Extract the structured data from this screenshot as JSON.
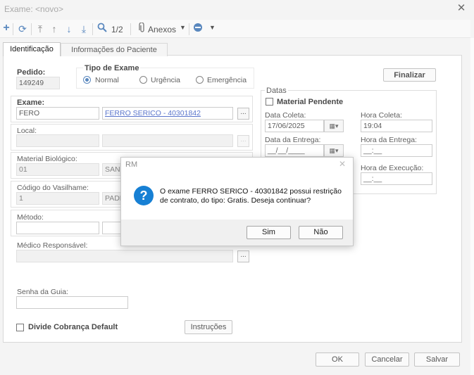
{
  "window": {
    "title": "Exame: <novo>"
  },
  "toolbar": {
    "page_indicator": "1/2",
    "attachments_label": "Anexos"
  },
  "tabs": [
    {
      "label": "Identificação"
    },
    {
      "label": "Informações do Paciente"
    }
  ],
  "form": {
    "pedido_label": "Pedido:",
    "pedido_value": "149249",
    "tipo_exame_label": "Tipo de Exame",
    "tipo_options": [
      "Normal",
      "Urgência",
      "Emergência"
    ],
    "exame_label": "Exame:",
    "exame_code": "FERO",
    "exame_desc": "FERRO SERICO - 40301842",
    "local_label": "Local:",
    "material_label": "Material Biológico:",
    "material_code": "01",
    "material_desc": "SANG",
    "vasilhame_label": "Código do Vasilhame:",
    "vasilhame_code": "1",
    "vasilhame_desc": "PADR",
    "metodo_label": "Método:",
    "medico_label": "Médico Responsável:",
    "senha_label": "Senha da Guia:",
    "divide_label": "Divide Cobrança Default",
    "instrucoes_btn": "Instruções",
    "finalizar_btn": "Finalizar",
    "dots": "..."
  },
  "datas": {
    "title": "Datas",
    "material_pendente": "Material Pendente",
    "data_coleta_label": "Data Coleta:",
    "data_coleta_value": "17/06/2025",
    "hora_coleta_label": "Hora Coleta:",
    "hora_coleta_value": "19:04",
    "data_entrega_label": "Data da Entrega:",
    "data_entrega_value": "__/__/____",
    "hora_entrega_label": "Hora da Entrega:",
    "hora_entrega_value": "__:__",
    "hora_execucao_label": "Hora de Execução:",
    "hora_execucao_value": "__:__"
  },
  "footer": {
    "ok": "OK",
    "cancelar": "Cancelar",
    "salvar": "Salvar"
  },
  "dialog": {
    "title": "RM",
    "message": "O exame FERRO SERICO - 40301842 possui restrição de contrato, do tipo: Gratis. Deseja continuar?",
    "yes": "Sim",
    "no": "Não"
  }
}
